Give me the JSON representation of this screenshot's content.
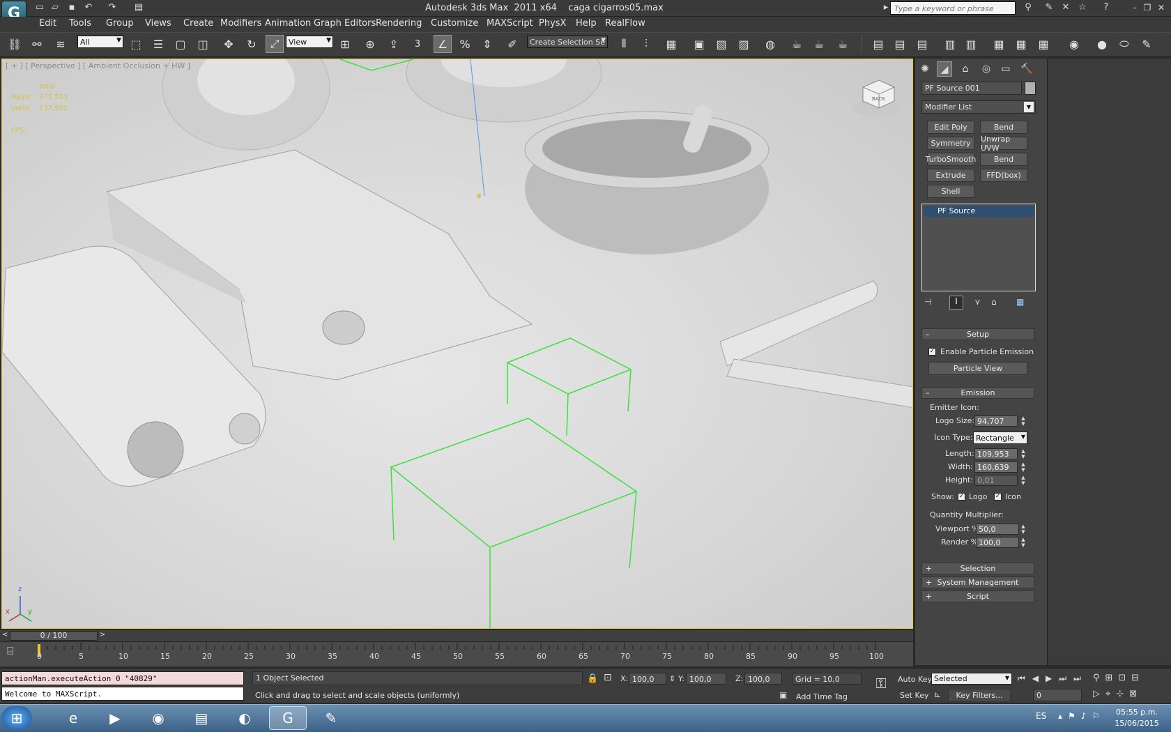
{
  "title": {
    "app": "Autodesk 3ds Max  2011 x64",
    "file": "caga cigarros05.max",
    "search_placeholder": "Type a keyword or phrase"
  },
  "menu": [
    "Edit",
    "Tools",
    "Group",
    "Views",
    "Create",
    "Modifiers",
    "Animation",
    "Graph Editors",
    "Rendering",
    "Customize",
    "MAXScript",
    "PhysX",
    "Help",
    "RealFlow"
  ],
  "toolbar": {
    "filter_value": "All",
    "ref_coord": "View",
    "selection_set": "Create Selection Se",
    "snap_3": "3"
  },
  "viewport": {
    "label": "[ + ] [ Perspective ] [ Ambient Occlusion + HW ]",
    "stats_total": "Total",
    "stats_polys_label": "Polys:",
    "stats_polys": "275.553",
    "stats_verts_label": "Verts:",
    "stats_verts": "137.902",
    "fps": "FPS:",
    "viewcube": "BACK",
    "axis_z": "z",
    "axis_x": "x",
    "axis_y": "y"
  },
  "command_panel": {
    "object_name": "PF Source 001",
    "modifier_list": "Modifier List",
    "modifier_buttons": [
      "Edit Poly",
      "Bend",
      "Symmetry",
      "Unwrap UVW",
      "TurboSmooth",
      "Bend",
      "Extrude",
      "FFD(box)",
      "Shell"
    ],
    "stack_item": "PF Source",
    "setup": {
      "header": "Setup",
      "enable_emission": "Enable Particle Emission",
      "particle_view": "Particle View"
    },
    "emission": {
      "header": "Emission",
      "emitter_icon": "Emitter Icon:",
      "logo_size_label": "Logo Size:",
      "logo_size": "94,707",
      "icon_type_label": "Icon Type:",
      "icon_type": "Rectangle",
      "length_label": "Length:",
      "length": "109,953",
      "width_label": "Width:",
      "width": "160,639",
      "height_label": "Height:",
      "height": "0,01",
      "show_label": "Show:",
      "show_logo": "Logo",
      "show_icon": "Icon",
      "qty_mult": "Quantity Multiplier:",
      "viewport_label": "Viewport %",
      "viewport_pct": "50,0",
      "render_label": "Render %",
      "render_pct": "100,0"
    },
    "rollouts_collapsed": [
      "Selection",
      "System Management",
      "Script"
    ]
  },
  "timeline": {
    "frame": "0 / 100",
    "ticks": [
      "0",
      "5",
      "10",
      "15",
      "20",
      "25",
      "30",
      "35",
      "40",
      "45",
      "50",
      "55",
      "60",
      "65",
      "70",
      "75",
      "80",
      "85",
      "90",
      "95",
      "100"
    ]
  },
  "status": {
    "maxscript_line1": "actionMan.executeAction 0 \"40829\"",
    "maxscript_line2": "Welcome to MAXScript.",
    "selected": "1 Object Selected",
    "prompt": "Click and drag to select and scale objects (uniformly)",
    "x_label": "X:",
    "x": "100,0",
    "y_label": "Y:",
    "y": "100,0",
    "z_label": "Z:",
    "z": "100,0",
    "grid": "Grid = 10,0",
    "add_time_tag": "Add Time Tag",
    "auto_key": "Auto Key",
    "set_key": "Set Key",
    "key_mode": "Selected",
    "key_filters": "Key Filters...",
    "current_frame": "0"
  },
  "taskbar": {
    "lang": "ES",
    "time": "05:55 p.m.",
    "date": "15/06/2015"
  }
}
